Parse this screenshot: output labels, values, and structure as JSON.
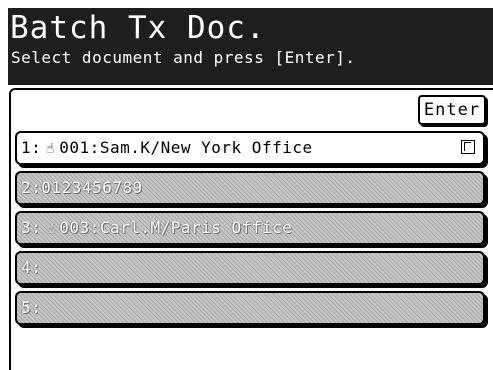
{
  "header": {
    "title": "Batch Tx Doc.",
    "subtitle": "Select document and press [Enter]."
  },
  "enter_button": {
    "label": "Enter"
  },
  "documents": [
    {
      "number": "1",
      "separator": ":",
      "icon": "hand-pointer-icon",
      "glyph": "☝",
      "text": "001:Sam.K/New York Office",
      "state": "selected"
    },
    {
      "number": "2",
      "separator": ":",
      "icon": "",
      "glyph": "",
      "text": "0123456789",
      "state": "disabled"
    },
    {
      "number": "3",
      "separator": ":",
      "icon": "hand-pointer-icon",
      "glyph": "☝",
      "text": "003:Carl.M/Paris Office",
      "state": "disabled"
    },
    {
      "number": "4",
      "separator": ":",
      "icon": "",
      "glyph": "",
      "text": "",
      "state": "disabled"
    },
    {
      "number": "5",
      "separator": ":",
      "icon": "",
      "glyph": "",
      "text": "",
      "state": "disabled"
    }
  ],
  "colors": {
    "header_bg": "#1e1e1e",
    "header_text": "#ffffff",
    "disabled_row": "#c9c9c9"
  }
}
